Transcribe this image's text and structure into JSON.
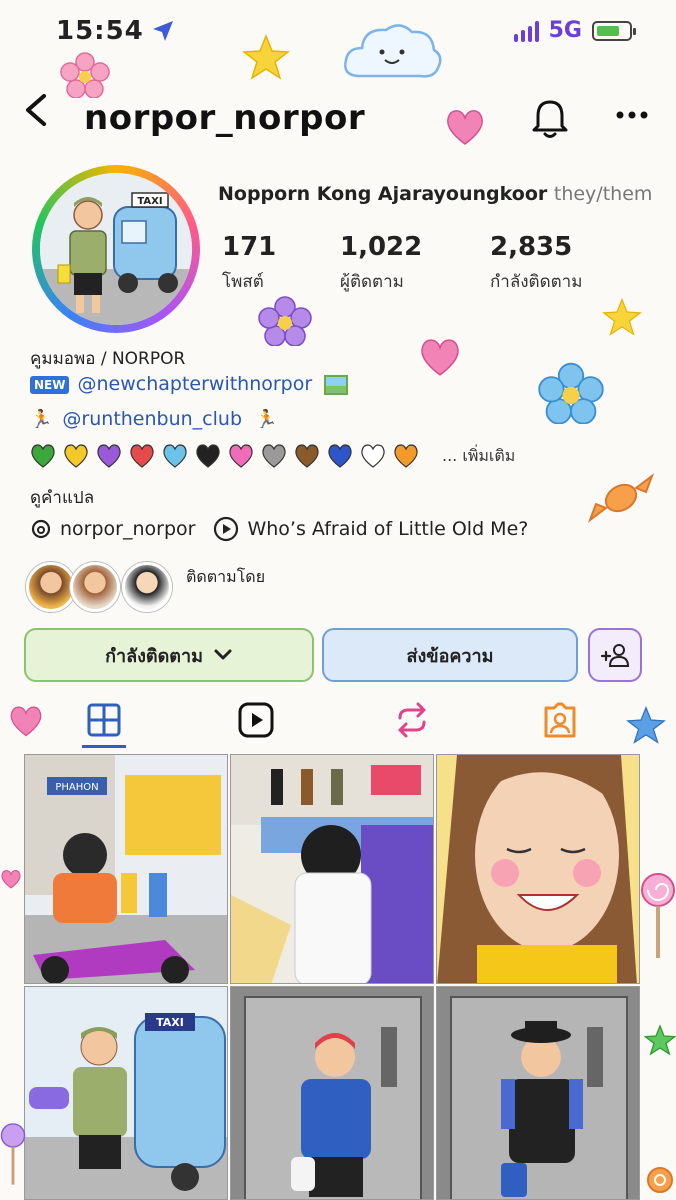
{
  "status_bar": {
    "time": "15:54",
    "network": "5G"
  },
  "header": {
    "username": "norpor_norpor"
  },
  "profile": {
    "full_name": "Nopporn Kong Ajarayoungkoor",
    "pronouns": "they/them",
    "avatar_label": "TAXI"
  },
  "stats": [
    {
      "value": "171",
      "label": "โพสต์"
    },
    {
      "value": "1,022",
      "label": "ผู้ติดตาม"
    },
    {
      "value": "2,835",
      "label": "กำลังติดตาม"
    }
  ],
  "bio": {
    "line1": "คูมมอพอ / NORPOR",
    "new_tag": "NEW",
    "link1": "@newchapterwithnorpor",
    "link2": "@runthenbun_club",
    "hearts": [
      "#3aa83a",
      "#f3c928",
      "#9b59d9",
      "#e74a4a",
      "#6cc3ea",
      "#222222",
      "#f06bb8",
      "#9a9a9a",
      "#8b5a2b",
      "#2f56c8",
      "#ffffff",
      "#f29b2b"
    ],
    "see_more": "... เพิ่มเติม",
    "translate": "ดูคำแปล",
    "threads_handle": "norpor_norpor",
    "music": "Who’s Afraid of Little Old Me?",
    "followed_by": "ติดตามโดย"
  },
  "buttons": {
    "following": "กำลังติดตาม",
    "message": "ส่งข้อความ"
  },
  "grid_labels": {
    "cell1_sign": "PHAHON",
    "cell4_sign": "TAXI"
  }
}
